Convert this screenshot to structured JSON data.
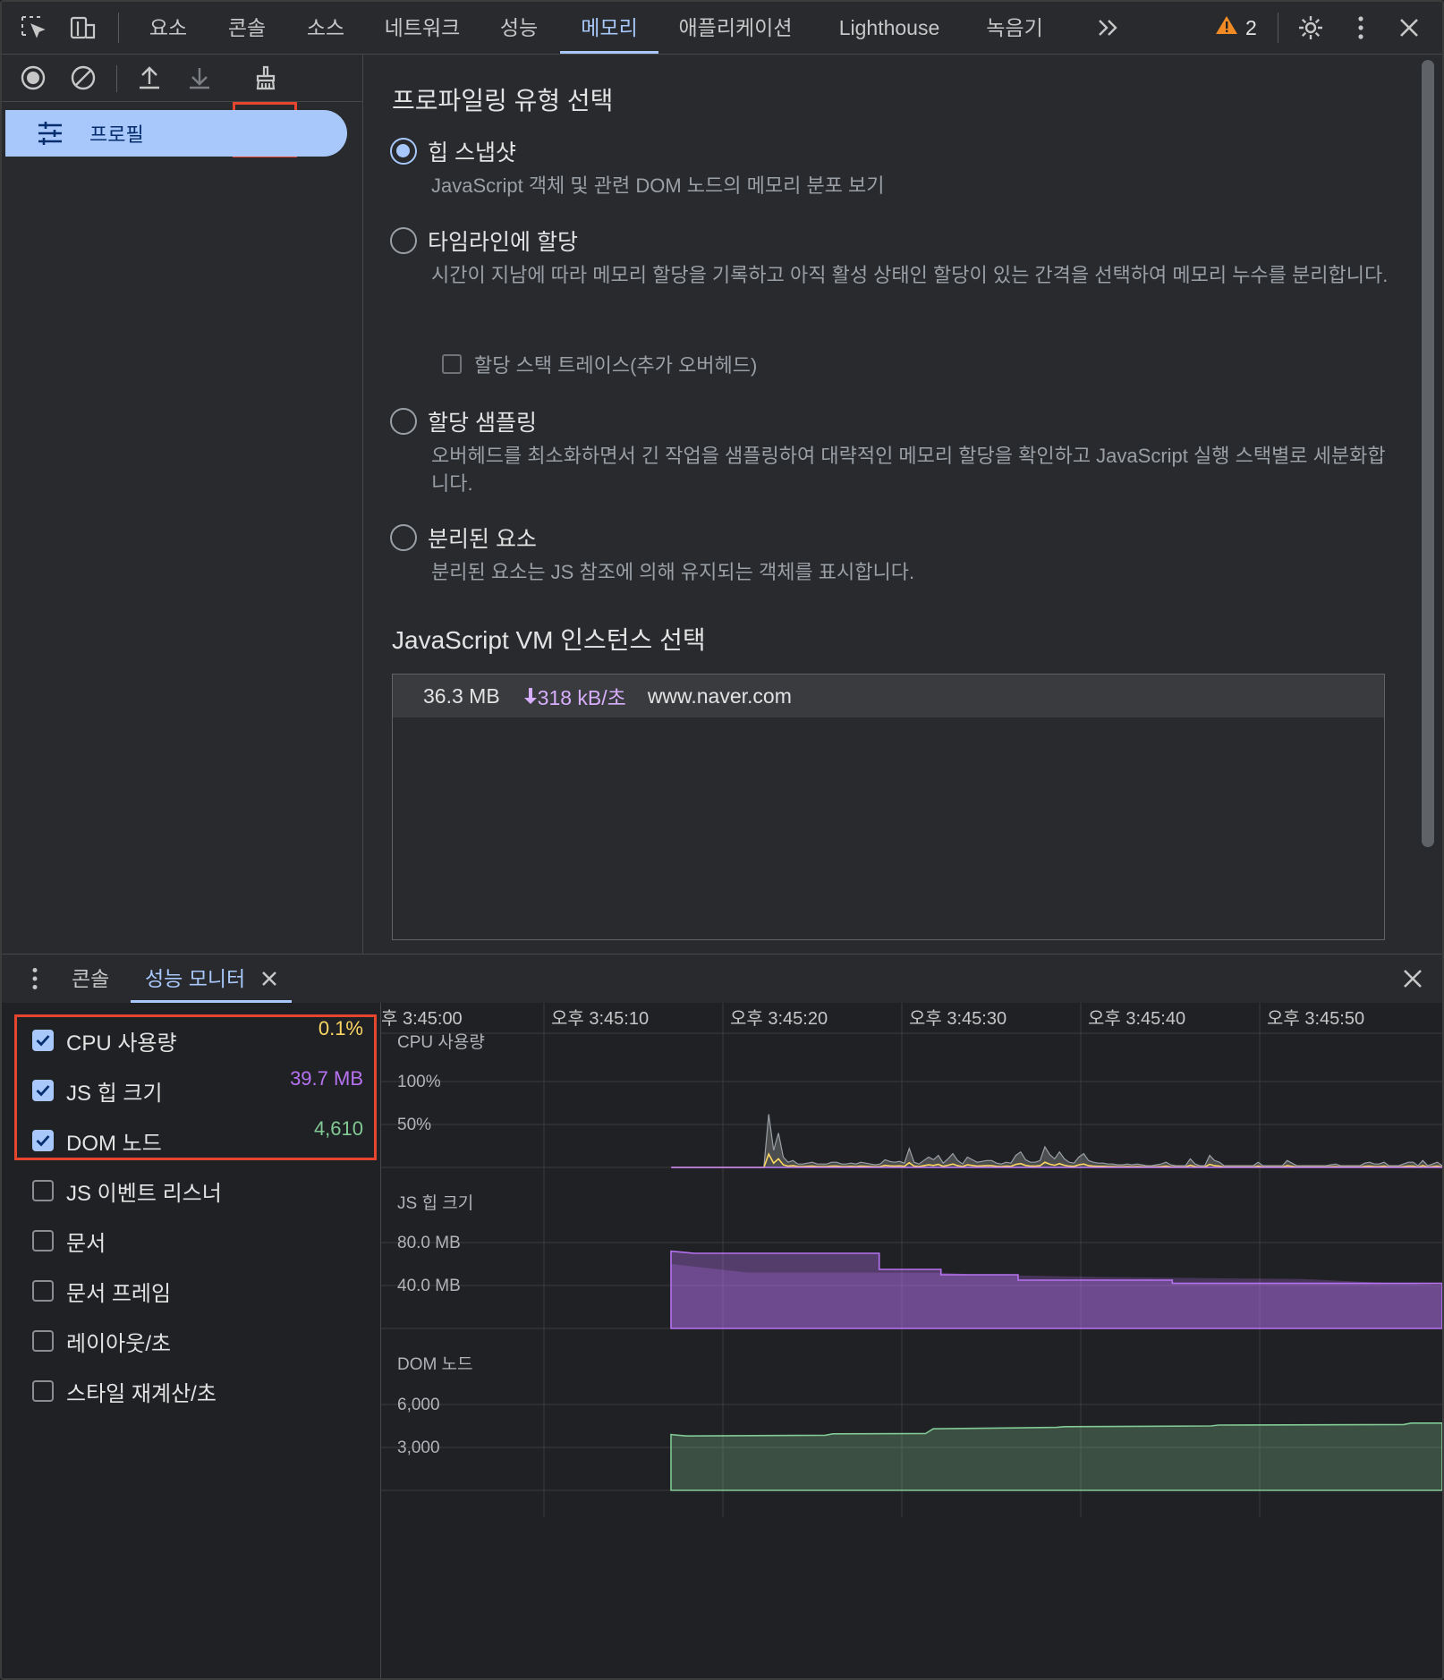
{
  "tabs": [
    "요소",
    "콘솔",
    "소스",
    "네트워크",
    "성능",
    "메모리",
    "애플리케이션",
    "Lighthouse",
    "녹음기"
  ],
  "active_tab": "메모리",
  "warnings_count": "2",
  "sidebar": {
    "profile_item": "프로필"
  },
  "content": {
    "heading": "프로파일링 유형 선택",
    "options": [
      {
        "label": "힙 스냅샷",
        "desc": "JavaScript 객체 및 관련 DOM 노드의 메모리 분포 보기",
        "selected": true
      },
      {
        "label": "타임라인에 할당",
        "desc": "시간이 지남에 따라 메모리 할당을 기록하고 아직 활성 상태인 할당이 있는 간격을 선택하여 메모리 누수를 분리합니다.",
        "selected": false
      },
      {
        "label": "할당 샘플링",
        "desc": "오버헤드를 최소화하면서 긴 작업을 샘플링하여 대략적인 메모리 할당을 확인하고 JavaScript 실행 스택별로 세분화합니다.",
        "selected": false
      },
      {
        "label": "분리된 요소",
        "desc": "분리된 요소는 JS 참조에 의해 유지되는 객체를 표시합니다.",
        "selected": false
      }
    ],
    "stack_trace_checkbox": "할당 스택 트레이스(추가 오버헤드)",
    "vm_heading": "JavaScript VM 인스턴스 선택",
    "vm_instance": {
      "memory": "36.3 MB",
      "rate": "318 kB/초",
      "url": "www.naver.com"
    }
  },
  "drawer": {
    "tabs": [
      "콘솔",
      "성능 모니터"
    ],
    "active": "성능 모니터"
  },
  "metrics": [
    {
      "label": "CPU 사용량",
      "value": "0.1%",
      "checked": true,
      "color": "#fdd663"
    },
    {
      "label": "JS 힙 크기",
      "value": "39.7 MB",
      "checked": true,
      "color": "#b772f2"
    },
    {
      "label": "DOM 노드",
      "value": "4,610",
      "checked": true,
      "color": "#81c995"
    },
    {
      "label": "JS 이벤트 리스너",
      "value": "",
      "checked": false
    },
    {
      "label": "문서",
      "value": "",
      "checked": false
    },
    {
      "label": "문서 프레임",
      "value": "",
      "checked": false
    },
    {
      "label": "레이아웃/초",
      "value": "",
      "checked": false
    },
    {
      "label": "스타일 재계산/초",
      "value": "",
      "checked": false
    }
  ],
  "chart_data": {
    "type": "area",
    "time_labels": [
      "후 3:45:00",
      "오후 3:45:10",
      "오후 3:45:20",
      "오후 3:45:30",
      "오후 3:45:40",
      "오후 3:45:50"
    ],
    "panels": [
      {
        "title": "CPU 사용량",
        "ticks": [
          "100%",
          "50%"
        ],
        "max": 100,
        "color": "#fdd663",
        "values": [
          0,
          0,
          0,
          0,
          0,
          0,
          0,
          0,
          0,
          0,
          0,
          0,
          0,
          0,
          0,
          0,
          0,
          0,
          0,
          0,
          0,
          0,
          0,
          0,
          0,
          0,
          0,
          0,
          0,
          0,
          0,
          0,
          0,
          0,
          0,
          0,
          0,
          0,
          0,
          0,
          0,
          0,
          0,
          0,
          0,
          0,
          0,
          0,
          0,
          0,
          0,
          0,
          0,
          0,
          0,
          0,
          0,
          0,
          0,
          0,
          0,
          0,
          0,
          0,
          0,
          0,
          0,
          0,
          0,
          0,
          0,
          0,
          0,
          0,
          0,
          0,
          0,
          0,
          0,
          0,
          62,
          20,
          40,
          12,
          6,
          8,
          4,
          4,
          5,
          6,
          4,
          4,
          4,
          6,
          6,
          4,
          4,
          5,
          4,
          6,
          5,
          4,
          3,
          4,
          9,
          7,
          6,
          7,
          5,
          22,
          6,
          4,
          8,
          12,
          9,
          14,
          5,
          10,
          16,
          8,
          4,
          12,
          9,
          6,
          7,
          8,
          8,
          5,
          4,
          6,
          5,
          14,
          18,
          9,
          6,
          6,
          8,
          24,
          15,
          10,
          18,
          10,
          6,
          5,
          12,
          16,
          8,
          6,
          5,
          5,
          4,
          4,
          3,
          3,
          4,
          3,
          4,
          3,
          2,
          2,
          3,
          4,
          6,
          3,
          2,
          2,
          2,
          10,
          4,
          2,
          2,
          14,
          8,
          6,
          2,
          2,
          2,
          2,
          2,
          2,
          2,
          6,
          2,
          2,
          2,
          2,
          2,
          8,
          5,
          2,
          2,
          2,
          2,
          2,
          2,
          2,
          3,
          4,
          2,
          2,
          2,
          2,
          2,
          5,
          6,
          4,
          4,
          6,
          2,
          2,
          2,
          4,
          6,
          6,
          2,
          8,
          2,
          4,
          6,
          2
        ]
      },
      {
        "title": "JS 힙 크기",
        "ticks": [
          "80.0 MB",
          "40.0 MB"
        ],
        "max": 80,
        "color": "#b772f2",
        "series_points": [
          [
            0,
            72
          ],
          [
            0.03,
            70
          ],
          [
            0.27,
            70
          ],
          [
            0.27,
            55
          ],
          [
            0.35,
            55
          ],
          [
            0.35,
            50
          ],
          [
            0.45,
            50
          ],
          [
            0.45,
            45
          ],
          [
            0.65,
            45
          ],
          [
            0.65,
            42
          ],
          [
            1,
            42
          ]
        ],
        "series_points_b": [
          [
            0,
            60
          ],
          [
            0.1,
            52
          ],
          [
            0.35,
            52
          ],
          [
            0.4,
            50
          ],
          [
            0.55,
            48
          ],
          [
            0.82,
            46
          ],
          [
            1,
            40
          ]
        ]
      },
      {
        "title": "DOM 노드",
        "ticks": [
          "6,000",
          "3,000"
        ],
        "max": 6000,
        "color": "#81c995",
        "series_points": [
          [
            0,
            3900
          ],
          [
            0.02,
            3800
          ],
          [
            0.2,
            3850
          ],
          [
            0.21,
            3950
          ],
          [
            0.33,
            3970
          ],
          [
            0.34,
            4300
          ],
          [
            0.5,
            4400
          ],
          [
            0.51,
            4450
          ],
          [
            0.7,
            4500
          ],
          [
            0.71,
            4560
          ],
          [
            0.95,
            4600
          ],
          [
            0.96,
            4700
          ],
          [
            1,
            4700
          ]
        ]
      }
    ]
  }
}
